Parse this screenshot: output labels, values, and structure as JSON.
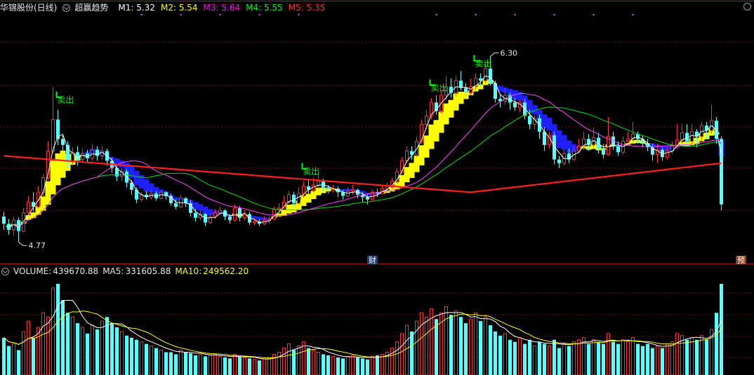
{
  "header": {
    "stock": "华锦股份(日线)",
    "indicator": "超赢趋势",
    "ma": [
      {
        "label": "M1:",
        "value": "5.32",
        "color": "#ffffff"
      },
      {
        "label": "M2:",
        "value": "5.54",
        "color": "#ffff00"
      },
      {
        "label": "M3:",
        "value": "5.64",
        "color": "#ff00ff"
      },
      {
        "label": "M4:",
        "value": "5.55",
        "color": "#00ff00"
      },
      {
        "label": "M5:",
        "value": "5.35",
        "color": "#ff3030"
      }
    ]
  },
  "volume_header": {
    "volume": {
      "label": "VOLUME:",
      "value": "439670.88",
      "color": "#ffffff"
    },
    "ma5": {
      "label": "MA5:",
      "value": "331605.88",
      "color": "#ffffff"
    },
    "ma10": {
      "label": "MA10:",
      "value": "249562.20",
      "color": "#ffff00"
    }
  },
  "chart_data": {
    "type": "candlestick",
    "price_ylim": [
      4.65,
      6.65
    ],
    "volume_ylim": [
      0,
      470000
    ],
    "colors": {
      "up": "#ff3232",
      "down": "#54ffff",
      "ma_short": "#ffffff",
      "ma_mid": "#ff40ff",
      "ma_long": "#00e000",
      "ma_trend": "#ff2020",
      "band_up": "#ffff00",
      "band_down": "#2020ff",
      "signal": "#00ff00",
      "badge": "#1a3a6a"
    },
    "annotations": {
      "max_label": "6.30",
      "min_label": "4.77",
      "sell_label": "卖出",
      "badge_fin": "财",
      "badge_pre": "预"
    },
    "sell_signals": [
      11,
      61,
      87,
      96
    ],
    "badge_fin_index": 75,
    "badge_pre_index": 150,
    "candles": [
      [
        4.98,
        4.92,
        5.02,
        4.87
      ],
      [
        4.92,
        4.87,
        4.96,
        4.83
      ],
      [
        4.87,
        4.95,
        4.98,
        4.82
      ],
      [
        4.95,
        4.86,
        4.97,
        4.77
      ],
      [
        4.86,
        5.01,
        5.05,
        4.85
      ],
      [
        5.01,
        5.1,
        5.15,
        4.98
      ],
      [
        5.1,
        5.06,
        5.18,
        5.02
      ],
      [
        5.06,
        5.18,
        5.23,
        5.05
      ],
      [
        5.18,
        5.3,
        5.33,
        5.14
      ],
      [
        5.3,
        5.52,
        5.6,
        5.28
      ],
      [
        5.52,
        5.78,
        6.05,
        5.5
      ],
      [
        5.78,
        5.62,
        5.86,
        5.57
      ],
      [
        5.62,
        5.57,
        5.66,
        5.48
      ],
      [
        5.57,
        5.43,
        5.6,
        5.38
      ],
      [
        5.43,
        5.51,
        5.55,
        5.4
      ],
      [
        5.51,
        5.45,
        5.56,
        5.4
      ],
      [
        5.45,
        5.5,
        5.54,
        5.42
      ],
      [
        5.5,
        5.46,
        5.53,
        5.42
      ],
      [
        5.46,
        5.53,
        5.58,
        5.44
      ],
      [
        5.53,
        5.48,
        5.56,
        5.44
      ],
      [
        5.48,
        5.52,
        5.56,
        5.45
      ],
      [
        5.52,
        5.44,
        5.54,
        5.4
      ],
      [
        5.44,
        5.38,
        5.47,
        5.34
      ],
      [
        5.38,
        5.31,
        5.4,
        5.27
      ],
      [
        5.31,
        5.35,
        5.38,
        5.27
      ],
      [
        5.35,
        5.26,
        5.37,
        5.22
      ],
      [
        5.26,
        5.2,
        5.28,
        5.16
      ],
      [
        5.2,
        5.12,
        5.22,
        5.09
      ],
      [
        5.12,
        5.16,
        5.18,
        5.1
      ],
      [
        5.16,
        5.14,
        5.19,
        5.12
      ],
      [
        5.14,
        5.17,
        5.2,
        5.12
      ],
      [
        5.17,
        5.13,
        5.19,
        5.11
      ],
      [
        5.13,
        5.18,
        5.2,
        5.12
      ],
      [
        5.18,
        5.15,
        5.19,
        5.12
      ],
      [
        5.15,
        5.09,
        5.17,
        5.07
      ],
      [
        5.09,
        5.06,
        5.12,
        5.04
      ],
      [
        5.06,
        5.13,
        5.16,
        5.05
      ],
      [
        5.13,
        5.09,
        5.14,
        5.06
      ],
      [
        5.09,
        5.01,
        5.12,
        4.98
      ],
      [
        5.01,
        4.97,
        5.04,
        4.94
      ],
      [
        4.97,
        5.0,
        5.03,
        4.95
      ],
      [
        5.0,
        4.93,
        5.01,
        4.9
      ],
      [
        4.93,
        4.98,
        5.0,
        4.92
      ],
      [
        4.98,
        5.01,
        5.04,
        4.96
      ],
      [
        5.01,
        5.03,
        5.06,
        4.99
      ],
      [
        5.03,
        4.98,
        5.04,
        4.95
      ],
      [
        4.98,
        4.95,
        5.0,
        4.92
      ],
      [
        4.95,
        5.05,
        5.08,
        4.94
      ],
      [
        5.05,
        4.97,
        5.07,
        4.94
      ],
      [
        4.97,
        5.0,
        5.03,
        4.95
      ],
      [
        5.0,
        4.93,
        5.02,
        4.91
      ],
      [
        4.93,
        4.94,
        4.96,
        4.91
      ],
      [
        4.94,
        4.92,
        4.96,
        4.9
      ],
      [
        4.92,
        4.95,
        4.98,
        4.91
      ],
      [
        4.95,
        4.96,
        4.98,
        4.92
      ],
      [
        4.96,
        5.04,
        5.06,
        4.95
      ],
      [
        5.04,
        5.05,
        5.09,
        5.01
      ],
      [
        5.05,
        5.1,
        5.15,
        5.04
      ],
      [
        5.1,
        5.16,
        5.19,
        5.09
      ],
      [
        5.16,
        5.09,
        5.18,
        5.06
      ],
      [
        5.09,
        5.17,
        5.22,
        5.08
      ],
      [
        5.17,
        5.23,
        5.27,
        5.14
      ],
      [
        5.23,
        5.2,
        5.28,
        5.16
      ],
      [
        5.2,
        5.24,
        5.3,
        5.18
      ],
      [
        5.24,
        5.27,
        5.32,
        5.21
      ],
      [
        5.27,
        5.22,
        5.29,
        5.18
      ],
      [
        5.22,
        5.2,
        5.24,
        5.17
      ],
      [
        5.2,
        5.21,
        5.24,
        5.18
      ],
      [
        5.21,
        5.18,
        5.23,
        5.14
      ],
      [
        5.18,
        5.15,
        5.2,
        5.12
      ],
      [
        5.15,
        5.19,
        5.22,
        5.14
      ],
      [
        5.19,
        5.2,
        5.24,
        5.16
      ],
      [
        5.2,
        5.16,
        5.21,
        5.13
      ],
      [
        5.16,
        5.14,
        5.18,
        5.1
      ],
      [
        5.14,
        5.12,
        5.16,
        5.08
      ],
      [
        5.12,
        5.18,
        5.2,
        5.11
      ],
      [
        5.18,
        5.17,
        5.21,
        5.14
      ],
      [
        5.17,
        5.21,
        5.24,
        5.16
      ],
      [
        5.21,
        5.23,
        5.26,
        5.19
      ],
      [
        5.23,
        5.27,
        5.3,
        5.21
      ],
      [
        5.27,
        5.35,
        5.38,
        5.25
      ],
      [
        5.35,
        5.44,
        5.47,
        5.33
      ],
      [
        5.44,
        5.52,
        5.56,
        5.42
      ],
      [
        5.52,
        5.49,
        5.56,
        5.45
      ],
      [
        5.49,
        5.6,
        5.64,
        5.47
      ],
      [
        5.6,
        5.74,
        5.78,
        5.58
      ],
      [
        5.74,
        5.81,
        5.86,
        5.7
      ],
      [
        5.81,
        5.92,
        5.96,
        5.78
      ],
      [
        5.92,
        5.85,
        5.98,
        5.82
      ],
      [
        5.85,
        5.98,
        6.02,
        5.83
      ],
      [
        5.98,
        6.05,
        6.14,
        5.94
      ],
      [
        6.05,
        6.0,
        6.12,
        5.96
      ],
      [
        6.0,
        6.1,
        6.14,
        5.97
      ],
      [
        6.1,
        6.04,
        6.18,
        6.02
      ],
      [
        6.04,
        6.0,
        6.08,
        5.95
      ],
      [
        6.0,
        6.05,
        6.12,
        5.98
      ],
      [
        6.05,
        6.12,
        6.16,
        6.02
      ],
      [
        6.12,
        6.1,
        6.16,
        6.05
      ],
      [
        6.1,
        6.2,
        6.24,
        6.08
      ],
      [
        6.2,
        6.08,
        6.3,
        6.06
      ],
      [
        6.08,
        5.95,
        6.1,
        5.92
      ],
      [
        5.95,
        5.93,
        5.99,
        5.88
      ],
      [
        5.93,
        5.98,
        6.04,
        5.9
      ],
      [
        5.98,
        5.92,
        6.0,
        5.86
      ],
      [
        5.92,
        5.88,
        5.96,
        5.85
      ],
      [
        5.88,
        5.92,
        5.94,
        5.84
      ],
      [
        5.92,
        5.81,
        5.95,
        5.78
      ],
      [
        5.81,
        5.74,
        5.86,
        5.7
      ],
      [
        5.74,
        5.79,
        5.82,
        5.7
      ],
      [
        5.79,
        5.68,
        5.82,
        5.62
      ],
      [
        5.68,
        5.57,
        5.72,
        5.52
      ],
      [
        5.57,
        5.65,
        5.68,
        5.54
      ],
      [
        5.65,
        5.45,
        5.68,
        5.41
      ],
      [
        5.45,
        5.42,
        5.48,
        5.38
      ],
      [
        5.42,
        5.5,
        5.53,
        5.4
      ],
      [
        5.5,
        5.45,
        5.54,
        5.42
      ],
      [
        5.45,
        5.52,
        5.56,
        5.44
      ],
      [
        5.52,
        5.56,
        5.62,
        5.5
      ],
      [
        5.56,
        5.62,
        5.68,
        5.53
      ],
      [
        5.62,
        5.57,
        5.66,
        5.52
      ],
      [
        5.57,
        5.63,
        5.71,
        5.55
      ],
      [
        5.63,
        5.54,
        5.67,
        5.5
      ],
      [
        5.54,
        5.49,
        5.58,
        5.46
      ],
      [
        5.49,
        5.64,
        5.8,
        5.48
      ],
      [
        5.64,
        5.56,
        5.68,
        5.53
      ],
      [
        5.56,
        5.51,
        5.6,
        5.48
      ],
      [
        5.51,
        5.6,
        5.64,
        5.49
      ],
      [
        5.6,
        5.62,
        5.68,
        5.56
      ],
      [
        5.62,
        5.66,
        5.76,
        5.6
      ],
      [
        5.66,
        5.62,
        5.68,
        5.58
      ],
      [
        5.62,
        5.58,
        5.65,
        5.55
      ],
      [
        5.58,
        5.55,
        5.62,
        5.52
      ],
      [
        5.55,
        5.49,
        5.58,
        5.44
      ],
      [
        5.49,
        5.53,
        5.58,
        5.42
      ],
      [
        5.53,
        5.47,
        5.55,
        5.44
      ],
      [
        5.47,
        5.52,
        5.55,
        5.45
      ],
      [
        5.52,
        5.56,
        5.6,
        5.5
      ],
      [
        5.56,
        5.61,
        5.74,
        5.54
      ],
      [
        5.61,
        5.67,
        5.74,
        5.58
      ],
      [
        5.67,
        5.6,
        5.74,
        5.56
      ],
      [
        5.6,
        5.68,
        5.74,
        5.58
      ],
      [
        5.68,
        5.64,
        5.7,
        5.55
      ],
      [
        5.64,
        5.73,
        5.76,
        5.6
      ],
      [
        5.73,
        5.69,
        5.76,
        5.62
      ],
      [
        5.69,
        5.77,
        5.9,
        5.66
      ],
      [
        5.77,
        5.62,
        5.8,
        5.58
      ],
      [
        5.62,
        5.08,
        5.64,
        5.03
      ]
    ],
    "volume": [
      180000,
      140000,
      150000,
      120000,
      210000,
      260000,
      180000,
      230000,
      300000,
      280000,
      420000,
      440000,
      360000,
      300000,
      280000,
      250000,
      230000,
      200000,
      240000,
      220000,
      260000,
      280000,
      250000,
      230000,
      210000,
      190000,
      180000,
      170000,
      160000,
      150000,
      140000,
      130000,
      120000,
      110000,
      110000,
      100000,
      120000,
      110000,
      105000,
      95000,
      100000,
      90000,
      95000,
      100000,
      90000,
      85000,
      80000,
      100000,
      90000,
      85000,
      80000,
      75000,
      70000,
      78000,
      82000,
      100000,
      110000,
      130000,
      150000,
      120000,
      140000,
      160000,
      130000,
      120000,
      110000,
      100000,
      95000,
      90000,
      85000,
      80000,
      90000,
      95000,
      85000,
      80000,
      75000,
      90000,
      95000,
      100000,
      110000,
      130000,
      160000,
      200000,
      240000,
      210000,
      260000,
      300000,
      280000,
      320000,
      270000,
      300000,
      330000,
      290000,
      310000,
      280000,
      250000,
      270000,
      300000,
      260000,
      280000,
      240000,
      210000,
      190000,
      200000,
      170000,
      160000,
      180000,
      150000,
      170000,
      140000,
      160000,
      150000,
      140000,
      170000,
      130000,
      150000,
      140000,
      160000,
      170000,
      180000,
      150000,
      170000,
      160000,
      150000,
      200000,
      160000,
      150000,
      170000,
      160000,
      180000,
      150000,
      140000,
      150000,
      130000,
      140000,
      130000,
      150000,
      160000,
      200000,
      190000,
      170000,
      180000,
      170000,
      190000,
      170000,
      220000,
      300000,
      439670
    ]
  }
}
